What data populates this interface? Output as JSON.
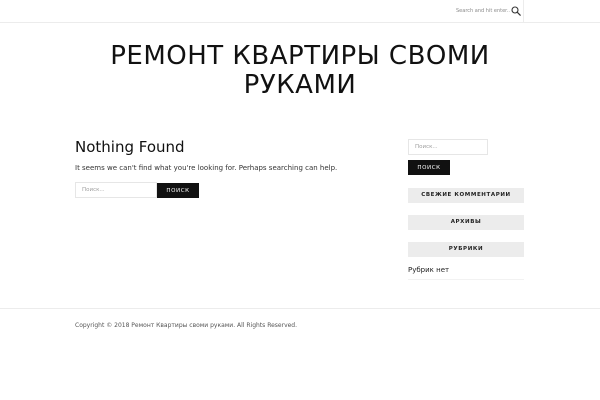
{
  "header": {
    "search_placeholder": "Search and hit enter...",
    "search_icon": "magnifier-icon"
  },
  "site": {
    "title_line1": "РЕМОНТ КВАРТИРЫ СВОМИ",
    "title_line2": "РУКАМИ"
  },
  "main": {
    "heading": "Nothing Found",
    "message": "It seems we can't find what you're looking for. Perhaps searching can help.",
    "search_placeholder": "Поиск...",
    "search_button": "ПОИСК"
  },
  "sidebar": {
    "search_placeholder": "Поиск...",
    "search_button": "ПОИСК",
    "widgets": [
      {
        "title": "СВЕЖИЕ КОММЕНТАРИИ"
      },
      {
        "title": "АРХИВЫ"
      },
      {
        "title": "РУБРИКИ"
      }
    ],
    "no_categories": "Рубрик нет"
  },
  "footer": {
    "copyright": "Copyright © 2018 Ремонт Квартиры своми руками. All Rights Reserved."
  }
}
